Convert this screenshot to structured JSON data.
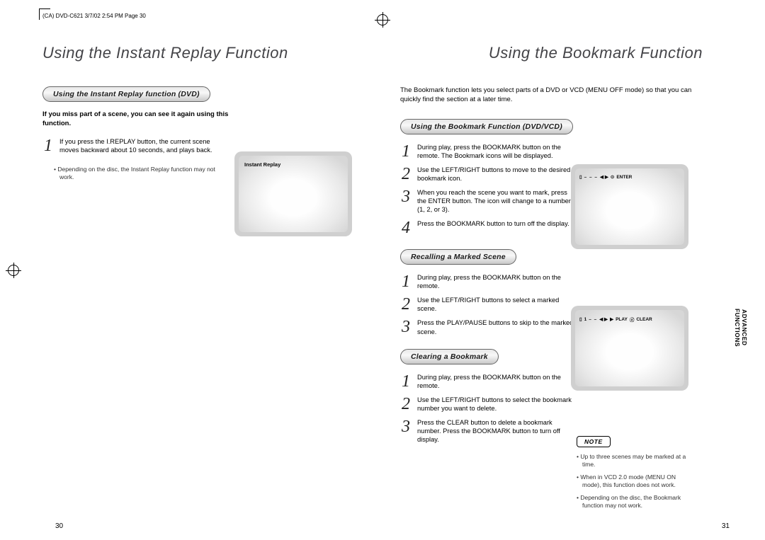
{
  "header_mark": "(CA) DVD-C621 3/7/02 2:54 PM  Page 30",
  "left": {
    "title": "Using the Instant Replay Function",
    "pill": "Using the Instant Replay function (DVD)",
    "intro": "If you miss part of a scene, you can see it again using this function.",
    "step1": "If you press the I.REPLAY button, the current scene moves backward about 10 seconds, and plays back.",
    "bullet": "Depending on the disc, the Instant Replay function may not work.",
    "screen_label": "Instant Replay",
    "pagenum": "30"
  },
  "right": {
    "title": "Using the Bookmark Function",
    "intro": "The Bookmark function lets you select parts of a DVD or VCD (MENU OFF mode) so that you can quickly find the section at a later time.",
    "section1": {
      "pill": "Using the Bookmark Function (DVD/VCD)",
      "step1": "During play, press the BOOKMARK button on the remote. The Bookmark icons will be displayed.",
      "step2": "Use the LEFT/RIGHT buttons to move to the desired bookmark icon.",
      "step3": "When you reach the scene you want to mark, press the ENTER button. The icon will change to a number (1, 2, or 3).",
      "step4": "Press the BOOKMARK button to turn off the display.",
      "osd": {
        "arrows": "◀ ▶",
        "enter_icon": "⊙",
        "enter": "ENTER"
      }
    },
    "section2": {
      "pill": "Recalling a Marked Scene",
      "step1": "During play, press the BOOKMARK button on the remote.",
      "step2": "Use the LEFT/RIGHT buttons to select a marked scene.",
      "step3": "Press the PLAY/PAUSE buttons to skip to the marked scene.",
      "osd": {
        "mark": "1",
        "arrows": "◀ ▶",
        "play_icon": "▶",
        "play": "PLAY",
        "clear_icon": "ⓧ",
        "clear": "CLEAR"
      }
    },
    "section3": {
      "pill": "Clearing a Bookmark",
      "step1": "During play, press the BOOKMARK button on the remote.",
      "step2": "Use the LEFT/RIGHT buttons to select the bookmark number you want to delete.",
      "step3": "Press the CLEAR button to delete a bookmark number. Press the BOOKMARK button to turn off display."
    },
    "notes": {
      "title": "NOTE",
      "n1": "Up to three scenes may be marked at a time.",
      "n2": "When in VCD 2.0 mode (MENU ON mode), this function does not work.",
      "n3": "Depending on the disc, the Bookmark function may not work."
    },
    "side_tab_line1": "ADVANCED",
    "side_tab_line2": "FUNCTIONS",
    "pagenum": "31"
  }
}
